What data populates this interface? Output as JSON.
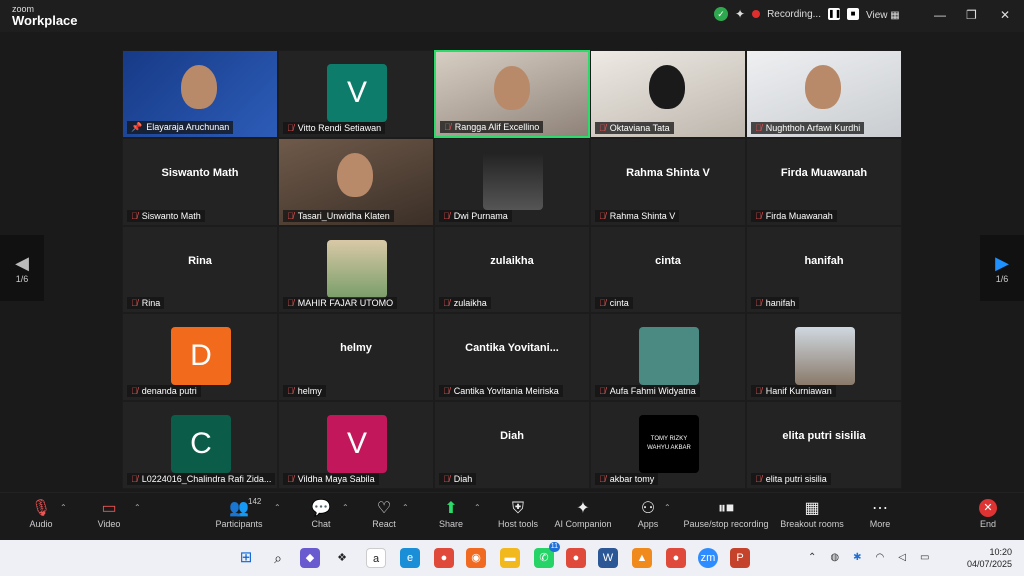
{
  "app": {
    "brand_small": "zoom",
    "brand_big": "Workplace"
  },
  "titlebar": {
    "recording_label": "Recording...",
    "view_label": "View"
  },
  "pager": {
    "left": "1/6",
    "right": "1/6"
  },
  "tiles": [
    {
      "name": "Elayaraja Aruchunan",
      "kind": "photo",
      "pinned": true
    },
    {
      "name": "Vitto Rendi Setiawan",
      "kind": "avatar",
      "letter": "V",
      "color": "#0e7c6b"
    },
    {
      "name": "Rangga Alif Excellino",
      "kind": "photo",
      "active": true
    },
    {
      "name": "Oktaviana Tata",
      "kind": "photo"
    },
    {
      "name": "Nughthoh Arfawi Kurdhi",
      "kind": "photo"
    },
    {
      "name": "Siswanto Math",
      "kind": "text",
      "big": "Siswanto Math"
    },
    {
      "name": "Tasari_Unwidha Klaten",
      "kind": "photo"
    },
    {
      "name": "Dwi Purnama",
      "kind": "small-photo"
    },
    {
      "name": "Rahma Shinta V",
      "kind": "text",
      "big": "Rahma Shinta V"
    },
    {
      "name": "Firda Muawanah",
      "kind": "text",
      "big": "Firda Muawanah"
    },
    {
      "name": "Rina",
      "kind": "text",
      "big": "Rina"
    },
    {
      "name": "MAHIR FAJAR UTOMO",
      "kind": "small-photo"
    },
    {
      "name": "zulaikha",
      "kind": "text",
      "big": "zulaikha"
    },
    {
      "name": "cinta",
      "kind": "text",
      "big": "cinta"
    },
    {
      "name": "hanifah",
      "kind": "text",
      "big": "hanifah"
    },
    {
      "name": "denanda putri",
      "kind": "avatar",
      "letter": "D",
      "color": "#f26b1d"
    },
    {
      "name": "helmy",
      "kind": "text",
      "big": "helmy"
    },
    {
      "name": "Cantika Yovitania Meiriska",
      "kind": "text",
      "big": "Cantika  Yovitani..."
    },
    {
      "name": "Aufa Fahmi Widyatna",
      "kind": "small-photo"
    },
    {
      "name": "Hanif Kurniawan",
      "kind": "small-photo"
    },
    {
      "name": "L0224016_Chalindra Rafi Zida...",
      "kind": "avatar",
      "letter": "C",
      "color": "#0b5d4a"
    },
    {
      "name": "Vildha Maya Sabila",
      "kind": "avatar",
      "letter": "V",
      "color": "#c2185b"
    },
    {
      "name": "Diah",
      "kind": "text",
      "big": "Diah"
    },
    {
      "name": "akbar tomy",
      "kind": "small-photo",
      "caption": "TOMY RIZKY WAHYU AKBAR"
    },
    {
      "name": "elita putri sisilia",
      "kind": "text",
      "big": "elita putri sisilia"
    }
  ],
  "toolbar": {
    "audio": "Audio",
    "video": "Video",
    "participants": "Participants",
    "participants_count": "142",
    "chat": "Chat",
    "react": "React",
    "share": "Share",
    "host_tools": "Host tools",
    "ai_companion": "AI Companion",
    "apps": "Apps",
    "pause_stop": "Pause/stop recording",
    "breakout": "Breakout rooms",
    "more": "More",
    "end": "End"
  },
  "taskbar": {
    "time": "10:20",
    "date": "04/07/2025",
    "badge_whatsapp": "11"
  }
}
